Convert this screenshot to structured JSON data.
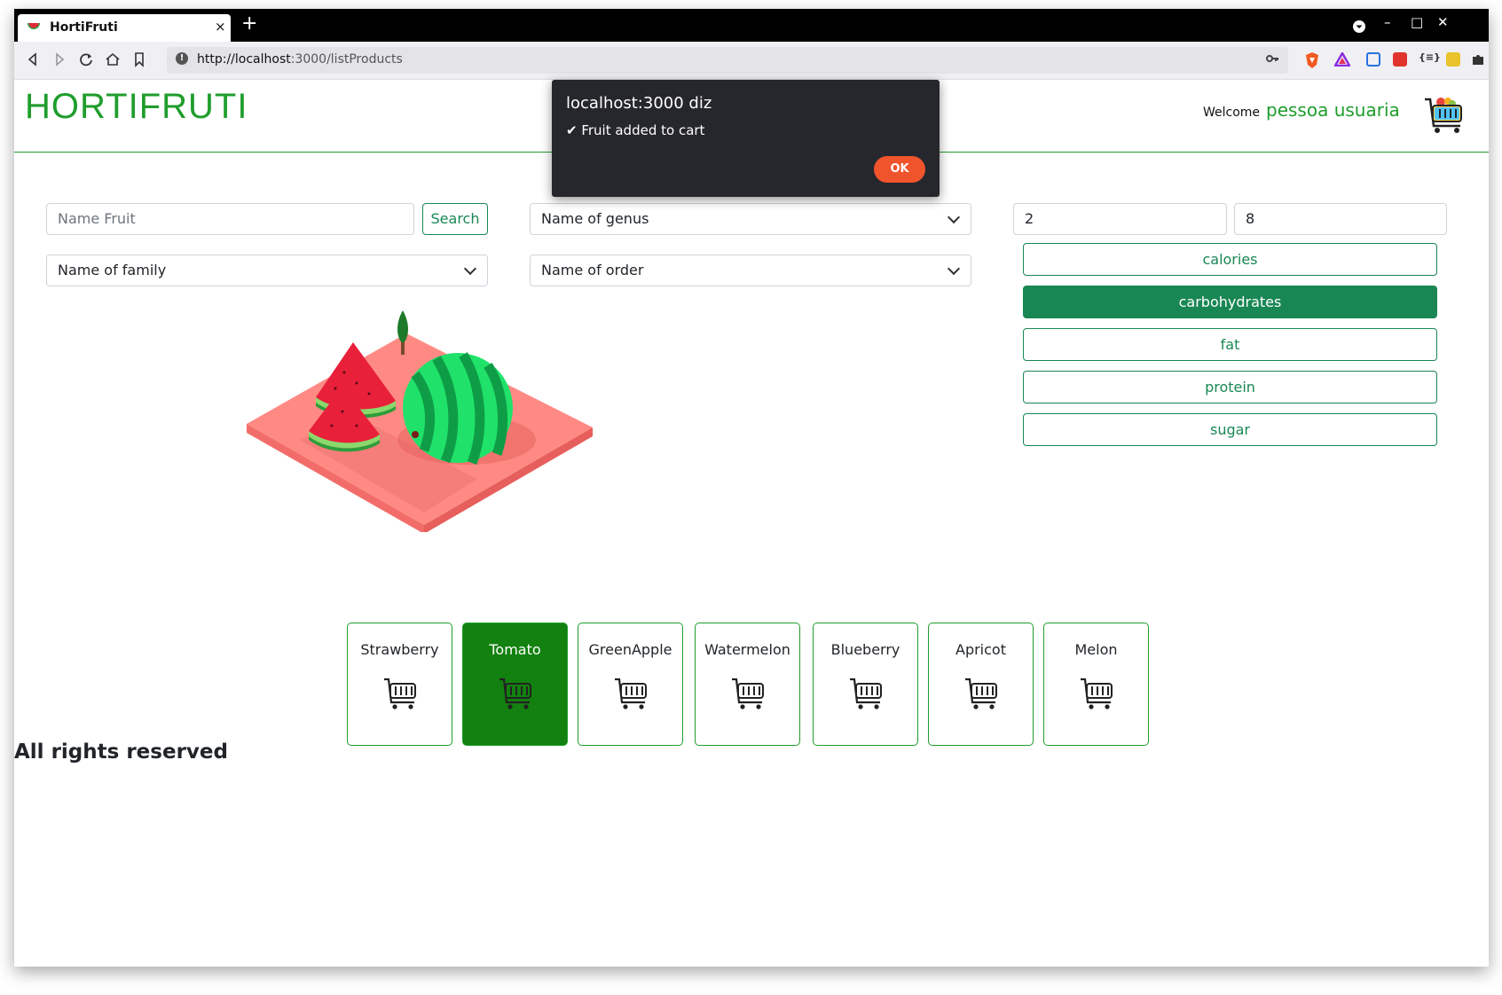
{
  "browser": {
    "tab_title": "HortiFruti",
    "tab_close": "×",
    "new_tab": "+",
    "url_host": "http://localhost",
    "url_path": ":3000/listProducts",
    "window_controls": {
      "minimize": "–",
      "maximize": "□",
      "close": "✕"
    }
  },
  "header": {
    "brand": "HORTIFRUTI",
    "welcome": "Welcome",
    "username": "pessoa usuaria"
  },
  "filters": {
    "name_placeholder": "Name Fruit",
    "search_label": "Search",
    "genus_value": "Name of genus",
    "family_value": "Name of family",
    "order_value": "Name of order",
    "min_value": "2",
    "max_value": "8"
  },
  "nutrients": [
    {
      "label": "calories",
      "active": false
    },
    {
      "label": "carbohydrates",
      "active": true
    },
    {
      "label": "fat",
      "active": false
    },
    {
      "label": "protein",
      "active": false
    },
    {
      "label": "sugar",
      "active": false
    }
  ],
  "products": [
    {
      "name": "Strawberry",
      "active": false
    },
    {
      "name": "Tomato",
      "active": true
    },
    {
      "name": "GreenApple",
      "active": false
    },
    {
      "name": "Watermelon",
      "active": false
    },
    {
      "name": "Blueberry",
      "active": false
    },
    {
      "name": "Apricot",
      "active": false
    },
    {
      "name": "Melon",
      "active": false
    }
  ],
  "footer": {
    "text": "All rights reserved"
  },
  "dialog": {
    "title": "localhost:3000 diz",
    "message": "✔ Fruit added to cart",
    "ok_label": "OK"
  },
  "colors": {
    "brand_green": "#1f9d2c",
    "button_green": "#198754",
    "active_card": "#12810f",
    "dialog_ok": "#f0542d"
  }
}
